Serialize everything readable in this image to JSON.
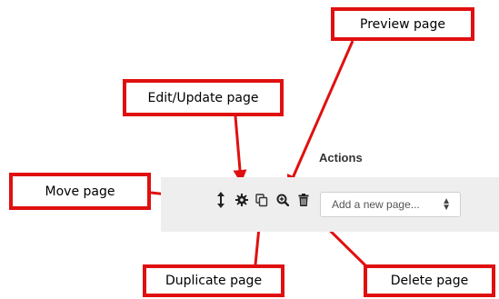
{
  "callouts": {
    "preview": "Preview page",
    "edit": "Edit/Update page",
    "move": "Move page",
    "duplicate": "Duplicate page",
    "delete": "Delete page"
  },
  "actions": {
    "heading": "Actions",
    "icons": [
      "move-icon",
      "gear-icon",
      "duplicate-icon",
      "zoom-in-icon",
      "trash-icon"
    ],
    "add_page_select": {
      "value": "Add a new page..."
    }
  },
  "colors": {
    "callout_red": "#e01010",
    "bar_background": "#eeeeee"
  }
}
